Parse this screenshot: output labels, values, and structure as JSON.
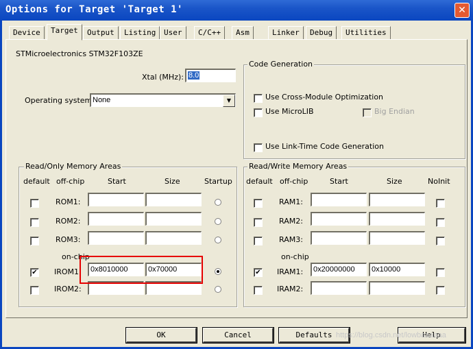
{
  "window": {
    "title": "Options for Target 'Target 1'",
    "close_glyph": "✕"
  },
  "tabs": [
    {
      "label": "Device"
    },
    {
      "label": "Target"
    },
    {
      "label": "Output"
    },
    {
      "label": "Listing"
    },
    {
      "label": "User"
    },
    {
      "label": "C/C++"
    },
    {
      "label": "Asm"
    },
    {
      "label": "Linker"
    },
    {
      "label": "Debug"
    },
    {
      "label": "Utilities"
    }
  ],
  "device_name": "STMicroelectronics STM32F103ZE",
  "xtal": {
    "label": "Xtal (MHz):",
    "value": "8.0"
  },
  "os": {
    "label": "Operating system:",
    "value": "None"
  },
  "code_gen": {
    "title": "Code Generation",
    "cross_module": "Use Cross-Module Optimization",
    "microlib": "Use MicroLIB",
    "big_endian": "Big Endian",
    "ltcg": "Use Link-Time Code Generation"
  },
  "ro": {
    "title": "Read/Only Memory Areas",
    "headers": {
      "default": "default",
      "offchip": "off-chip",
      "start": "Start",
      "size": "Size",
      "startup": "Startup"
    },
    "onchip": "on-chip",
    "rows": [
      {
        "name": "ROM1:",
        "start": "",
        "size": "",
        "default": false,
        "startup": false
      },
      {
        "name": "ROM2:",
        "start": "",
        "size": "",
        "default": false,
        "startup": false
      },
      {
        "name": "ROM3:",
        "start": "",
        "size": "",
        "default": false,
        "startup": false
      },
      {
        "name": "IROM1:",
        "start": "0x8010000",
        "size": "0x70000",
        "default": true,
        "startup": true
      },
      {
        "name": "IROM2:",
        "start": "",
        "size": "",
        "default": false,
        "startup": false
      }
    ]
  },
  "rw": {
    "title": "Read/Write Memory Areas",
    "headers": {
      "default": "default",
      "offchip": "off-chip",
      "start": "Start",
      "size": "Size",
      "noinit": "NoInit"
    },
    "onchip": "on-chip",
    "rows": [
      {
        "name": "RAM1:",
        "start": "",
        "size": "",
        "default": false
      },
      {
        "name": "RAM2:",
        "start": "",
        "size": "",
        "default": false
      },
      {
        "name": "RAM3:",
        "start": "",
        "size": "",
        "default": false
      },
      {
        "name": "IRAM1:",
        "start": "0x20000000",
        "size": "0x10000",
        "default": true
      },
      {
        "name": "IRAM2:",
        "start": "",
        "size": "",
        "default": false
      }
    ]
  },
  "buttons": {
    "ok": "OK",
    "cancel": "Cancel",
    "defaults": "Defaults",
    "help": "Help"
  },
  "watermark": "https://blog.csdn.net/lowbaaaaaa",
  "check_glyph": "✔",
  "colors": {
    "titlebar": "#0a46c0",
    "highlight": "#e60000",
    "dialog_bg": "#ece9d8"
  }
}
